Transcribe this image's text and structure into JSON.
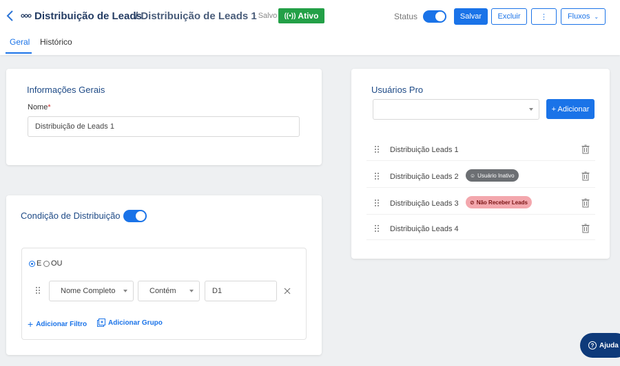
{
  "header": {
    "title": "Distribuição de Leads",
    "subtitle": "/ Distribuição de Leads 1",
    "saved_label": "- Salvo",
    "status_badge": "Ativo",
    "status_label": "Status",
    "save_button": "Salvar",
    "delete_button": "Excluir",
    "more_button": "⋮",
    "flows_button": "Fluxos"
  },
  "tabs": [
    {
      "label": "Geral",
      "active": true
    },
    {
      "label": "Histórico",
      "active": false
    }
  ],
  "general_info": {
    "title": "Informações Gerais",
    "name_label": "Nome",
    "required_mark": "*",
    "name_value": "Distribuição de Leads 1"
  },
  "distribution_condition": {
    "title": "Condição de Distribuição",
    "enabled": true,
    "logic_options": [
      {
        "label": "E",
        "selected": true
      },
      {
        "label": "OU",
        "selected": false
      }
    ],
    "filter": {
      "field": "Nome Completo",
      "operator": "Contém",
      "value": "D1"
    },
    "add_filter": "Adicionar Filtro",
    "add_group": "Adicionar Grupo"
  },
  "pro_users": {
    "title": "Usuários Pro",
    "select_value": "",
    "add_button": "+ Adicionar",
    "items": [
      {
        "name": "Distribuição Leads 1",
        "badge": ""
      },
      {
        "name": "Distribuição Leads 2",
        "badge": "Usuário Inativo"
      },
      {
        "name": "Distribuição Leads 3",
        "badge": "Não Receber Leads"
      },
      {
        "name": "Distribuição Leads 4",
        "badge": ""
      }
    ]
  },
  "help_button": "Ajuda",
  "colors": {
    "primary": "#1a73e8",
    "active_green": "#23a047",
    "title_navy": "#243c63",
    "inactive_gray": "#6c6f73",
    "no_leads_pink": "#f3a7ad"
  }
}
